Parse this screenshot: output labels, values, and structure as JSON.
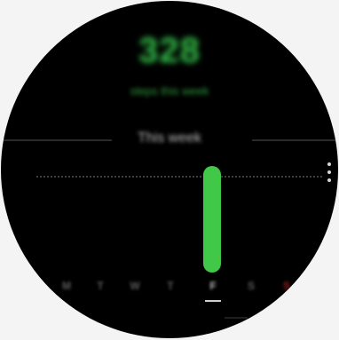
{
  "summary": {
    "value": "328",
    "caption": "steps this week"
  },
  "period": {
    "label": "This week"
  },
  "goal": {
    "ratio_of_goal": 1.0
  },
  "week": {
    "days": [
      {
        "label": "M",
        "value_ratio": 0
      },
      {
        "label": "T",
        "value_ratio": 0
      },
      {
        "label": "W",
        "value_ratio": 0
      },
      {
        "label": "T",
        "value_ratio": 0
      },
      {
        "label": "F",
        "value_ratio": 1.1,
        "current": true
      },
      {
        "label": "S",
        "value_ratio": 0
      },
      {
        "label": "S",
        "value_ratio": 0,
        "sunday": true
      }
    ]
  },
  "colors": {
    "accent": "#42c848",
    "sunday": "#a12020"
  },
  "icons": {
    "more": "more-options-icon"
  }
}
